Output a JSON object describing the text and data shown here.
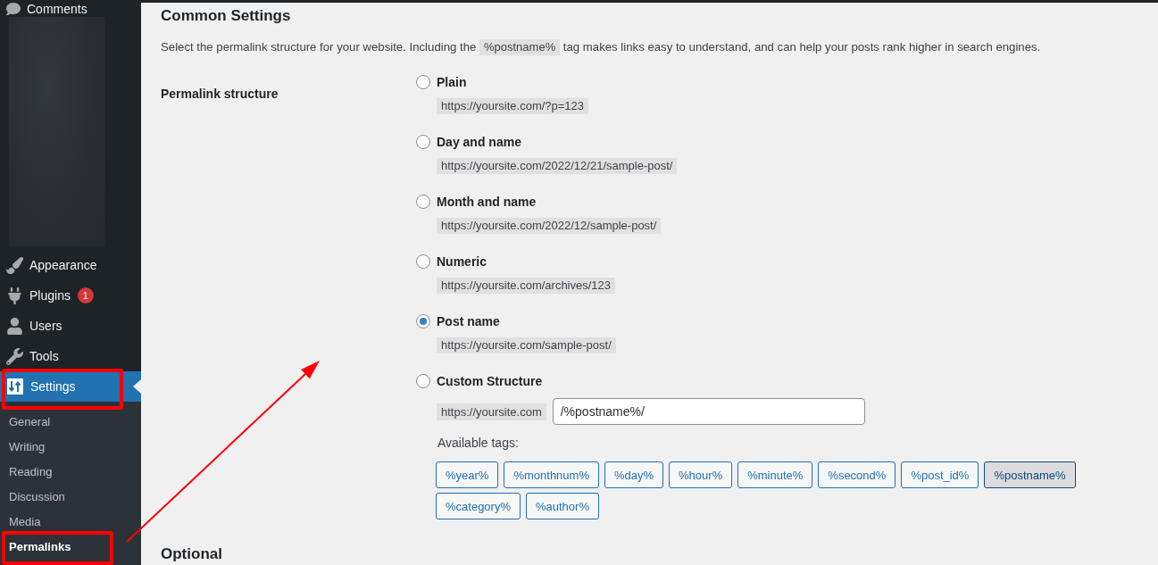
{
  "sidebar": {
    "items": [
      {
        "label": "Comments",
        "selected": false
      },
      {
        "label": "Appearance",
        "selected": false
      },
      {
        "label": "Plugins",
        "selected": false,
        "badge": "1"
      },
      {
        "label": "Users",
        "selected": false
      },
      {
        "label": "Tools",
        "selected": false
      },
      {
        "label": "Settings",
        "selected": true,
        "submenu": [
          {
            "label": "General",
            "selected": false
          },
          {
            "label": "Writing",
            "selected": false
          },
          {
            "label": "Reading",
            "selected": false
          },
          {
            "label": "Discussion",
            "selected": false
          },
          {
            "label": "Media",
            "selected": false
          },
          {
            "label": "Permalinks",
            "selected": true
          }
        ]
      }
    ]
  },
  "section": {
    "title": "Common Settings",
    "description_before": "Select the permalink structure for your website. Including the ",
    "description_code": "%postname%",
    "description_after": " tag makes links easy to understand, and can help your posts rank higher in search engines."
  },
  "form": {
    "label": "Permalink structure",
    "options": [
      {
        "kind": "preset",
        "label": "Plain",
        "example": "https://yoursite.com/?p=123",
        "selected": false
      },
      {
        "kind": "preset",
        "label": "Day and name",
        "example": "https://yoursite.com/2022/12/21/sample-post/",
        "selected": false
      },
      {
        "kind": "preset",
        "label": "Month and name",
        "example": "https://yoursite.com/2022/12/sample-post/",
        "selected": false
      },
      {
        "kind": "preset",
        "label": "Numeric",
        "example": "https://yoursite.com/archives/123",
        "selected": false
      },
      {
        "kind": "preset",
        "label": "Post name",
        "example": "https://yoursite.com/sample-post/",
        "selected": true
      },
      {
        "kind": "custom",
        "label": "Custom Structure",
        "selected": false,
        "prefix": "https://yoursite.com",
        "value": "/%postname%/",
        "tags_label": "Available tags:",
        "tags": [
          {
            "label": "%year%",
            "selected": false
          },
          {
            "label": "%monthnum%",
            "selected": false
          },
          {
            "label": "%day%",
            "selected": false
          },
          {
            "label": "%hour%",
            "selected": false
          },
          {
            "label": "%minute%",
            "selected": false
          },
          {
            "label": "%second%",
            "selected": false
          },
          {
            "label": "%post_id%",
            "selected": false
          },
          {
            "label": "%postname%",
            "selected": true
          },
          {
            "label": "%category%",
            "selected": false
          },
          {
            "label": "%author%",
            "selected": false
          }
        ]
      }
    ]
  },
  "next_section": {
    "title": "Optional"
  }
}
